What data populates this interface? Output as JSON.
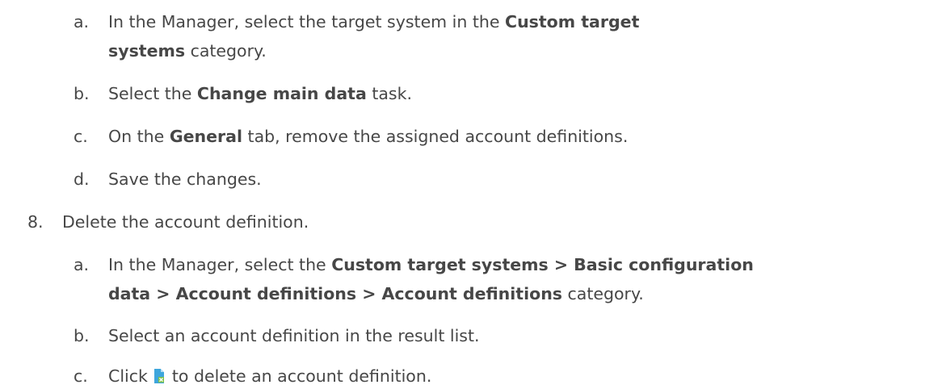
{
  "steps": {
    "a1": {
      "marker": "a.",
      "line1_pre": "In the Manager, select the target system in the ",
      "line1_bold": "Custom target",
      "line2_bold": "systems",
      "line2_post": "  category."
    },
    "b1": {
      "marker": "b.",
      "pre": "Select the ",
      "bold": "Change main data",
      "post": " task."
    },
    "c1": {
      "marker": "c.",
      "pre": "On the ",
      "bold": "General",
      "post": " tab, remove the assigned account definitions."
    },
    "d1": {
      "marker": "d.",
      "text": "Save the changes."
    },
    "step8": {
      "marker": "8.",
      "text": "Delete the account definition."
    },
    "a2": {
      "marker": "a.",
      "line1_pre": "In the Manager, select the ",
      "line1_bold": "Custom target systems > Basic configuration",
      "line2_bold": "data > Account definitions > Account definitions",
      "line2_post": " category."
    },
    "b2": {
      "marker": "b.",
      "text": "Select an account definition in the result list."
    },
    "c2": {
      "marker": "c.",
      "pre": "Click ",
      "icon": "delete-document-icon",
      "post": " to delete an account definition."
    }
  },
  "colors": {
    "text": "#474747",
    "icon_page": "#3ea6dc",
    "icon_fold": "#ffffff",
    "icon_badge": "#7fc24a"
  }
}
